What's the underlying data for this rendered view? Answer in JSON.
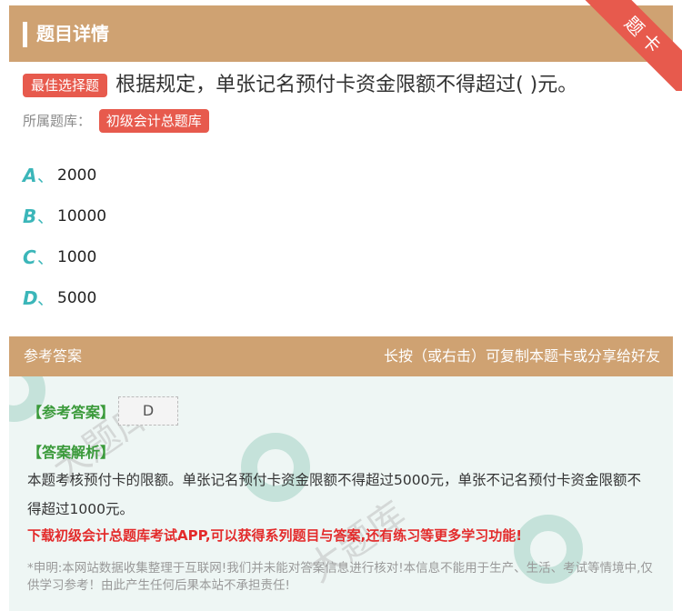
{
  "header": {
    "title": "题目详情",
    "ribbon": "题卡"
  },
  "question": {
    "type_tag": "最佳选择题",
    "text": "根据规定，单张记名预付卡资金限额不得超过( )元。",
    "bank_label": "所属题库：",
    "bank_name": "初级会计总题库"
  },
  "options": [
    {
      "letter": "A",
      "sep": "、",
      "text": "2000"
    },
    {
      "letter": "B",
      "sep": "、",
      "text": "10000"
    },
    {
      "letter": "C",
      "sep": "、",
      "text": "1000"
    },
    {
      "letter": "D",
      "sep": "、",
      "text": "5000"
    }
  ],
  "answer": {
    "header_left": "参考答案",
    "header_right": "长按（或右击）可复制本题卡或分享给好友",
    "ref_label": "【参考答案】",
    "ref_value": "D",
    "analysis_label": "【答案解析】",
    "explanation": "本题考核预付卡的限额。单张记名预付卡资金限额不得超过5000元，单张不记名预付卡资金限额不得超过1000元。",
    "promo": "下载初级会计总题库考试APP,可以获得系列题目与答案,还有练习等更多学习功能!",
    "disclaimer": "*申明:本网站数据收集整理于互联网!我们并未能对答案信息进行核对!本信息不能用于生产、生活、考试等情境中,仅供学习参考！由此产生任何后果本站不承担责任!"
  },
  "colors": {
    "header_bg": "#cfa272",
    "accent_red": "#e75a4d",
    "option_letter": "#3bb6b9",
    "answer_green": "#3a9a3a",
    "promo_red": "#e32b2b"
  }
}
